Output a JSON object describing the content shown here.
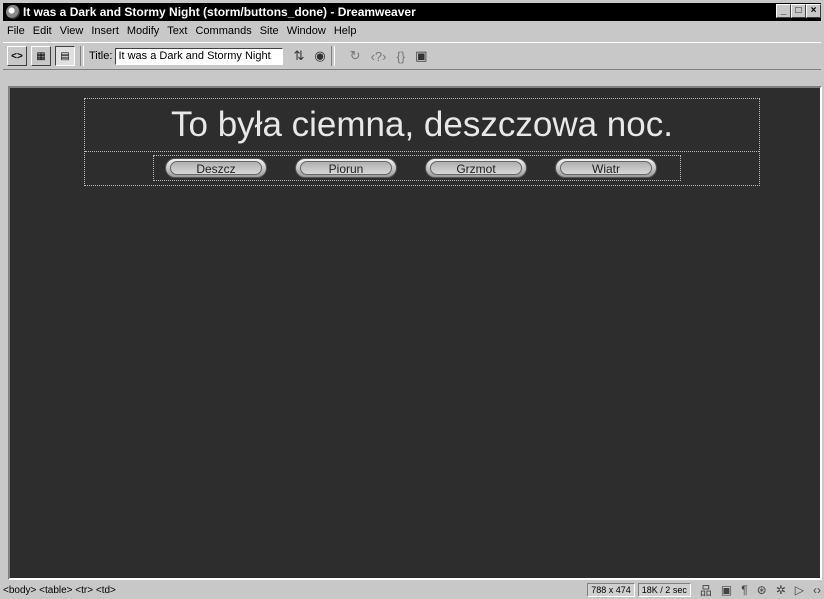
{
  "window": {
    "title": "It was a Dark and Stormy Night (storm/buttons_done) - Dreamweaver",
    "controls": {
      "minimize": "_",
      "maximize": "□",
      "close": "×"
    }
  },
  "menu": [
    "File",
    "Edit",
    "View",
    "Insert",
    "Modify",
    "Text",
    "Commands",
    "Site",
    "Window",
    "Help"
  ],
  "toolbar": {
    "title_label": "Title:",
    "title_value": "It was a Dark and Stormy Night",
    "icons": [
      "code-view-icon",
      "split-view-icon",
      "design-view-icon",
      "file-management-icon",
      "preview-browser-icon",
      "refresh-icon",
      "code-navigation-icon",
      "view-options-icon",
      "visual-aids-icon"
    ]
  },
  "document": {
    "heading": "To była ciemna, deszczowa noc.",
    "buttons": [
      "Deszcz",
      "Piorun",
      "Grzmot",
      "Wiatr"
    ],
    "background": "#2d2d2d"
  },
  "statusbar": {
    "tags": "<body> <table> <tr> <td>",
    "window_size": "788 x 474",
    "download": "18K / 2 sec"
  }
}
